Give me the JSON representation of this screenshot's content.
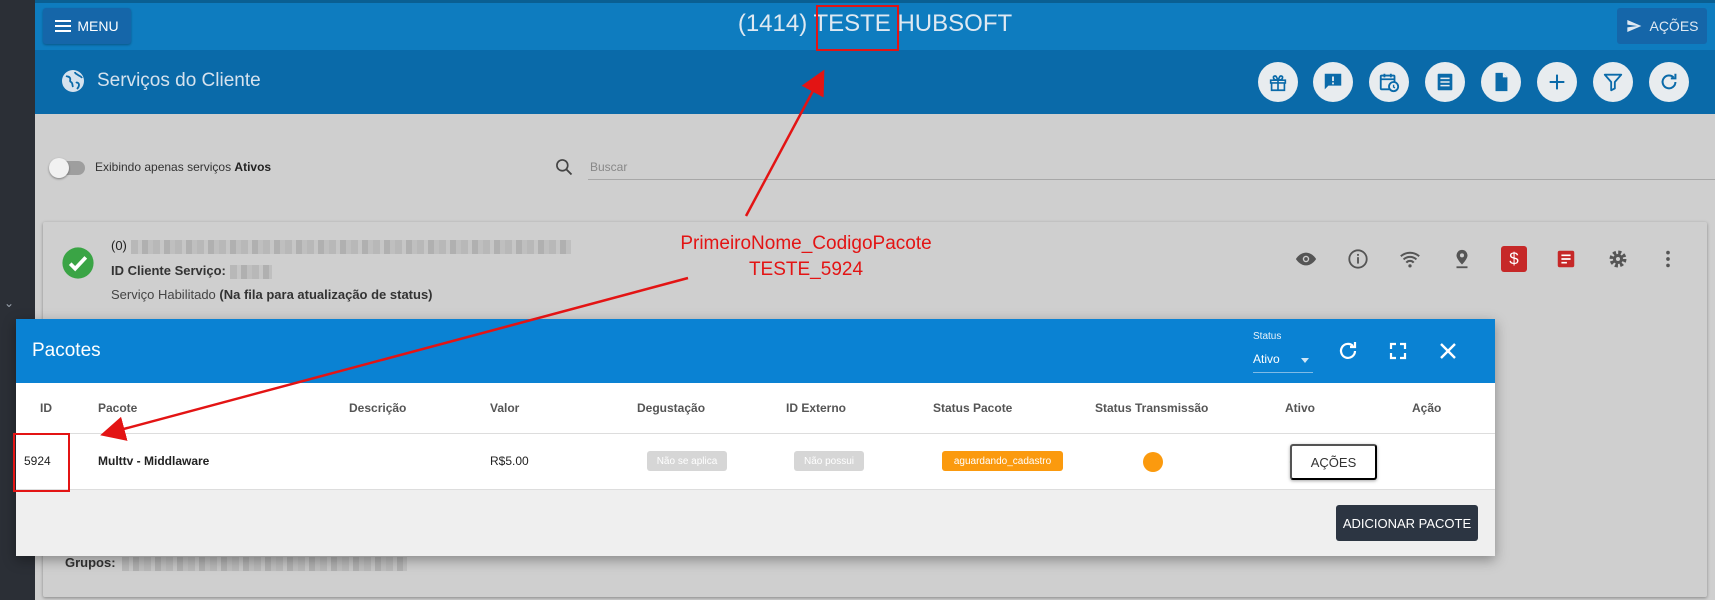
{
  "topbar": {
    "menu_label": "MENU",
    "title": "(1414) TESTE HUBSOFT",
    "actions_label": "AÇÕES"
  },
  "subheader": {
    "title": "Serviços do Cliente",
    "icons": [
      "gift-icon",
      "feedback-icon",
      "schedule-icon",
      "list-icon",
      "document-icon",
      "add-icon",
      "filter-icon",
      "refresh-icon"
    ]
  },
  "filters": {
    "toggle_label": "Exibindo apenas serviços ",
    "toggle_label_bold": "Ativos",
    "search_placeholder": "Buscar"
  },
  "service": {
    "line1_prefix": "(0)",
    "id_label": "ID Cliente Serviço:",
    "status_text": "Serviço Habilitado ",
    "status_bold": "(Na fila para atualização de status)",
    "groups_label": "Grupos:",
    "action_icons": [
      "eye-icon",
      "info-icon",
      "wifi-icon",
      "location-icon",
      "billing-icon",
      "notes-icon",
      "settings-icon",
      "more-vert-icon"
    ]
  },
  "modal": {
    "title": "Pacotes",
    "status_label": "Status",
    "status_value": "Ativo",
    "columns": [
      "ID",
      "Pacote",
      "Descrição",
      "Valor",
      "Degustação",
      "ID Externo",
      "Status Pacote",
      "Status Transmissão",
      "Ativo",
      "Ação"
    ],
    "row": {
      "id": "5924",
      "pacote": "Multtv - Middlaware",
      "descricao": "",
      "valor": "R$5.00",
      "degustacao": "Não se aplica",
      "id_externo": "Não possui",
      "status_pacote": "aguardando_cadastro",
      "acao_label": "AÇÕES"
    },
    "add_label": "ADICIONAR PACOTE"
  },
  "annotation": {
    "line1": "PrimeiroNome_CodigoPacote",
    "line2": "TESTE_5924",
    "color": "#e31414"
  },
  "colors": {
    "topbar": "#0e7cbf",
    "subheader": "#0a6aa9",
    "modal_header": "#0a82d3",
    "status_orange": "#fb9a0e",
    "ok_green": "#3aa445",
    "badge_red": "#c62828"
  }
}
